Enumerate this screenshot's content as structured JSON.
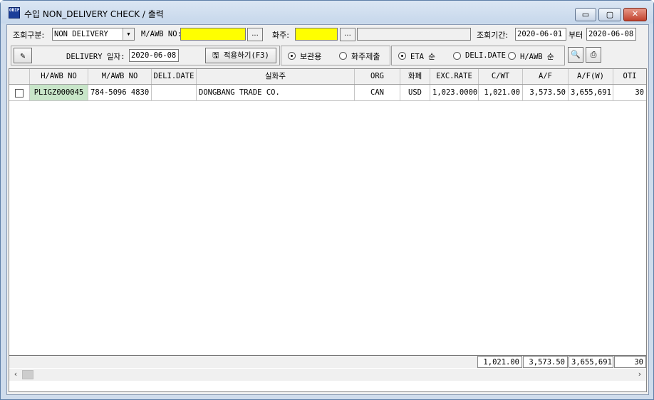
{
  "window": {
    "title": "수입  NON_DELIVERY CHECK / 출력",
    "icon_text": "OBIF",
    "min_glyph": "▭",
    "max_glyph": "▢",
    "close_glyph": "✕"
  },
  "filters": {
    "type_label": "조회구분:",
    "type_value": "NON DELIVERY",
    "mawb_label": "M/AWB NO:",
    "mawb_value": "",
    "shipper_label": "화주:",
    "shipper_value": "",
    "shipper_name": "",
    "period_label": "조회기간:",
    "period_from": "2020-06-01",
    "period_sep": "부터",
    "period_to": "2020-06-08",
    "browse_label": "..."
  },
  "actions": {
    "delivery_date_label": "DELIVERY 일자:",
    "delivery_date_value": "2020-06-08",
    "apply_label": "적용하기(F3)",
    "mode_storage": "보관용",
    "mode_shipper": "화주제출",
    "sort_eta": "ETA 순",
    "sort_deli": "DELI.DATE",
    "sort_hawb": "H/AWB 순",
    "selected_mode": "storage",
    "selected_sort": "eta"
  },
  "grid": {
    "columns": [
      "H/AWB NO",
      "M/AWB NO",
      "DELI.DATE",
      "실화주",
      "ORG",
      "화폐",
      "EXC.RATE",
      "C/WT",
      "A/F",
      "A/F(W)",
      "OTI"
    ],
    "rows": [
      {
        "hawb": "PLIGZ000045",
        "mawb": "784-5096 4830",
        "deli_date": "",
        "consignee": "DONGBANG TRADE CO.",
        "org": "CAN",
        "currency": "USD",
        "exc_rate": "1,023.0000",
        "cwt": "1,021.00",
        "af": "3,573.50",
        "af_w": "3,655,691",
        "oti": "30"
      }
    ],
    "totals": {
      "cwt": "1,021.00",
      "af": "3,573.50",
      "af_w": "3,655,691",
      "oti": "30"
    }
  },
  "colors": {
    "highlight_field": "#ffff00",
    "hawb_cell": "#c8e6c9"
  }
}
